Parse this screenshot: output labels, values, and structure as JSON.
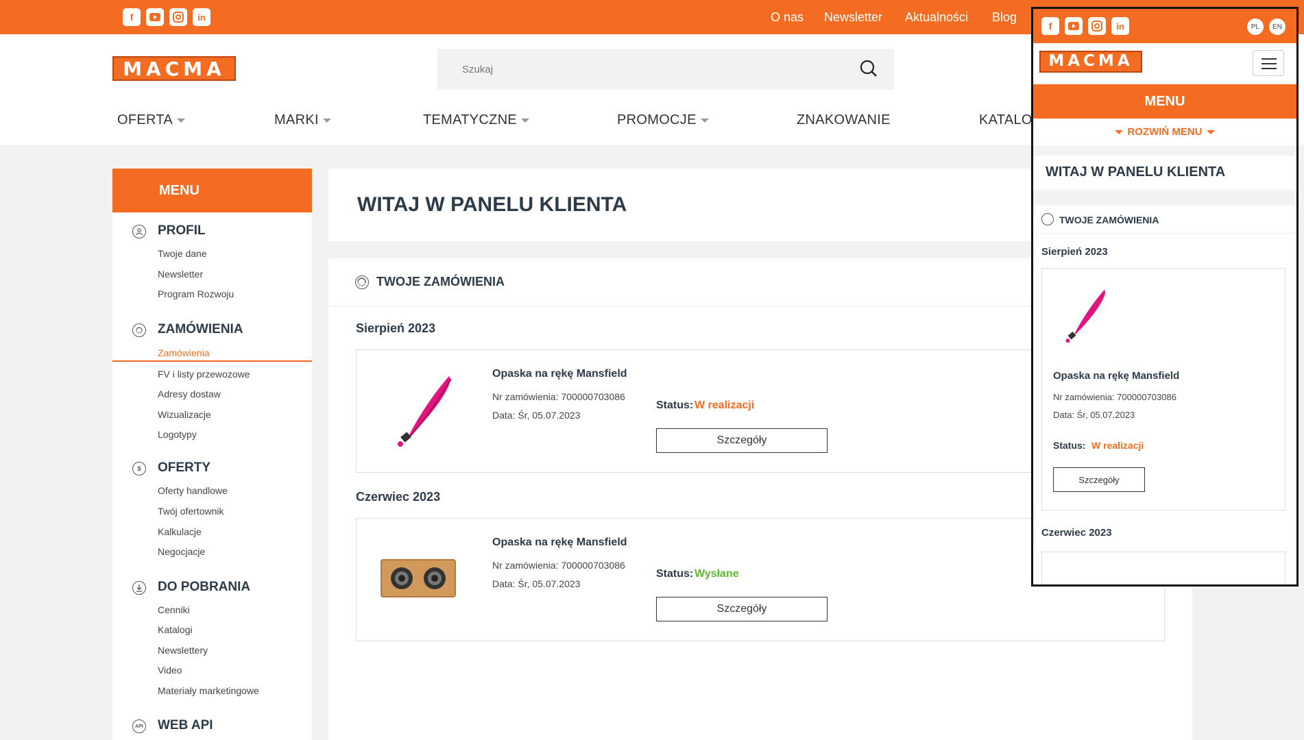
{
  "topbar": {
    "social": [
      "facebook-icon",
      "youtube-icon",
      "instagram-icon",
      "linkedin-icon"
    ],
    "links": [
      "O nas",
      "Newsletter",
      "Aktualności",
      "Blog"
    ]
  },
  "logo": {
    "text": "MACMA"
  },
  "search": {
    "placeholder": "Szukaj"
  },
  "nav": [
    "OFERTA",
    "MARKI",
    "TEMATYCZNE",
    "PROMOCJE",
    "ZNAKOWANIE",
    "KATALOG"
  ],
  "sidebar": {
    "menu_label": "MENU",
    "sections": [
      {
        "title": "PROFIL",
        "items": [
          "Twoje dane",
          "Newsletter",
          "Program Rozwoju"
        ]
      },
      {
        "title": "ZAMÓWIENIA",
        "items": [
          "Zamówienia",
          "FV i listy przewozowe",
          "Adresy dostaw",
          "Wizualizacje",
          "Logotypy"
        ]
      },
      {
        "title": "OFERTY",
        "items": [
          "Oferty handlowe",
          "Twój ofertownik",
          "Kalkulacje",
          "Negocjacje"
        ]
      },
      {
        "title": "DO POBRANIA",
        "items": [
          "Cenniki",
          "Katalogi",
          "Newslettery",
          "Video",
          "Materiały marketingowe"
        ]
      },
      {
        "title": "WEB API",
        "items": []
      }
    ]
  },
  "main": {
    "title": "WITAJ W PANELU KLIENTA",
    "orders_title": "TWOJE ZAMÓWIENIA",
    "groups": [
      {
        "month": "Sierpień 2023",
        "order": {
          "product": "Opaska na rękę Mansfield",
          "nr": "Nr zamówienia: 700000703086",
          "date": "Data: Śr, 05.07.2023",
          "status_label": "Status:",
          "status": "W realizacji",
          "status_color": "#f36c21",
          "button": "Szczegóły"
        }
      },
      {
        "month": "Czerwiec 2023",
        "order": {
          "product": "Opaska na rękę Mansfield",
          "nr": "Nr zamówienia: 700000703086",
          "date": "Data: Śr, 05.07.2023",
          "status_label": "Status:",
          "status": "Wysłane",
          "status_color": "#5cb82e",
          "button": "Szczegóły"
        }
      }
    ]
  },
  "mobile": {
    "langs": [
      "PL",
      "EN"
    ],
    "menu_label": "MENU",
    "expand_label": "ROZWIŃ MENU",
    "title": "WITAJ W PANELU KLIENTA",
    "orders_title": "TWOJE ZAMÓWIENIA",
    "month1": "Sierpień 2023",
    "order": {
      "product": "Opaska na rękę Mansfield",
      "nr": "Nr zamówienia: 700000703086",
      "date": "Data: Śr, 05.07.2023",
      "status_label": "Status:",
      "status": "W realizacji",
      "button": "Szczegóły"
    },
    "month2": "Czerwiec 2023"
  },
  "colors": {
    "accent": "#f36c21",
    "status_green": "#5cb82e",
    "text": "#2d3a48"
  }
}
